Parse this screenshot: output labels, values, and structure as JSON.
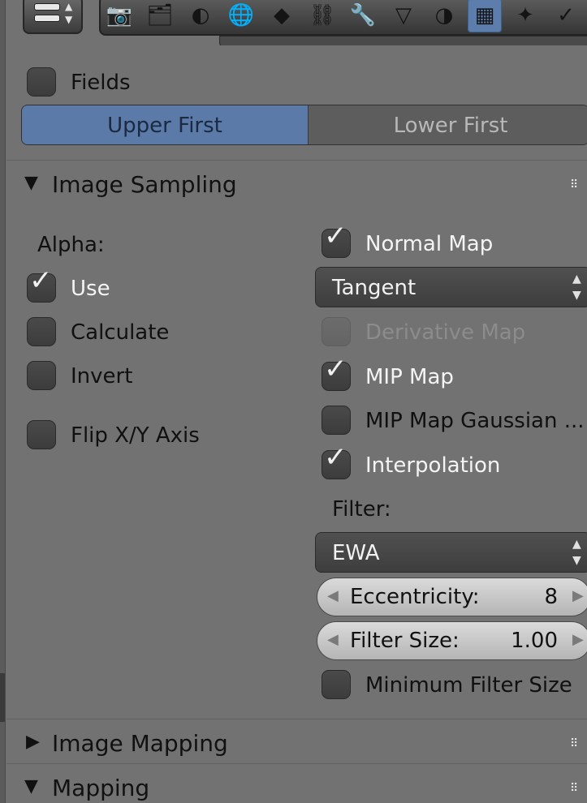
{
  "header": {
    "menu_button_icon": "editor-type-menu-icon",
    "tabs": [
      {
        "icon": "render-camera-icon",
        "glyph": "📷",
        "active": false
      },
      {
        "icon": "render-layers-icon",
        "glyph": "🗂",
        "active": false
      },
      {
        "icon": "scene-icon",
        "glyph": "◐",
        "active": false
      },
      {
        "icon": "world-icon",
        "glyph": "🌐",
        "active": false
      },
      {
        "icon": "object-icon",
        "glyph": "◆",
        "active": false
      },
      {
        "icon": "constraints-icon",
        "glyph": "⛓",
        "active": false
      },
      {
        "icon": "modifiers-wrench-icon",
        "glyph": "🔧",
        "active": false
      },
      {
        "icon": "object-data-icon",
        "glyph": "▽",
        "active": false
      },
      {
        "icon": "material-icon",
        "glyph": "◑",
        "active": false
      },
      {
        "icon": "texture-checker-icon",
        "glyph": "▦",
        "active": true
      },
      {
        "icon": "particles-icon",
        "glyph": "✦",
        "active": false
      },
      {
        "icon": "physics-icon",
        "glyph": "✓",
        "active": false
      }
    ]
  },
  "fields": {
    "label": "Fields",
    "checked": false,
    "order_left": "Upper First",
    "order_right": "Lower First",
    "selected": "Upper First"
  },
  "image_sampling": {
    "title": "Image Sampling",
    "expanded": true,
    "alpha_label": "Alpha:",
    "use": {
      "label": "Use",
      "checked": true
    },
    "calculate": {
      "label": "Calculate",
      "checked": false
    },
    "invert": {
      "label": "Invert",
      "checked": false
    },
    "flip_axis": {
      "label": "Flip X/Y Axis",
      "checked": false
    },
    "normal_map": {
      "label": "Normal Map",
      "checked": true
    },
    "normal_space": "Tangent",
    "derivative_map": {
      "label": "Derivative Map",
      "checked": false,
      "enabled": false
    },
    "mip_map": {
      "label": "MIP Map",
      "checked": true
    },
    "mip_map_gaussian": {
      "label": "MIP Map Gaussian ...",
      "checked": false
    },
    "interpolation": {
      "label": "Interpolation",
      "checked": true
    },
    "filter_label": "Filter:",
    "filter_value": "EWA",
    "eccentricity": {
      "label": "Eccentricity:",
      "value": "8"
    },
    "filter_size": {
      "label": "Filter Size:",
      "value": "1.00"
    },
    "min_filter_size": {
      "label": "Minimum Filter Size",
      "checked": false
    }
  },
  "image_mapping": {
    "title": "Image Mapping",
    "expanded": false
  },
  "mapping": {
    "title": "Mapping",
    "expanded": true
  }
}
